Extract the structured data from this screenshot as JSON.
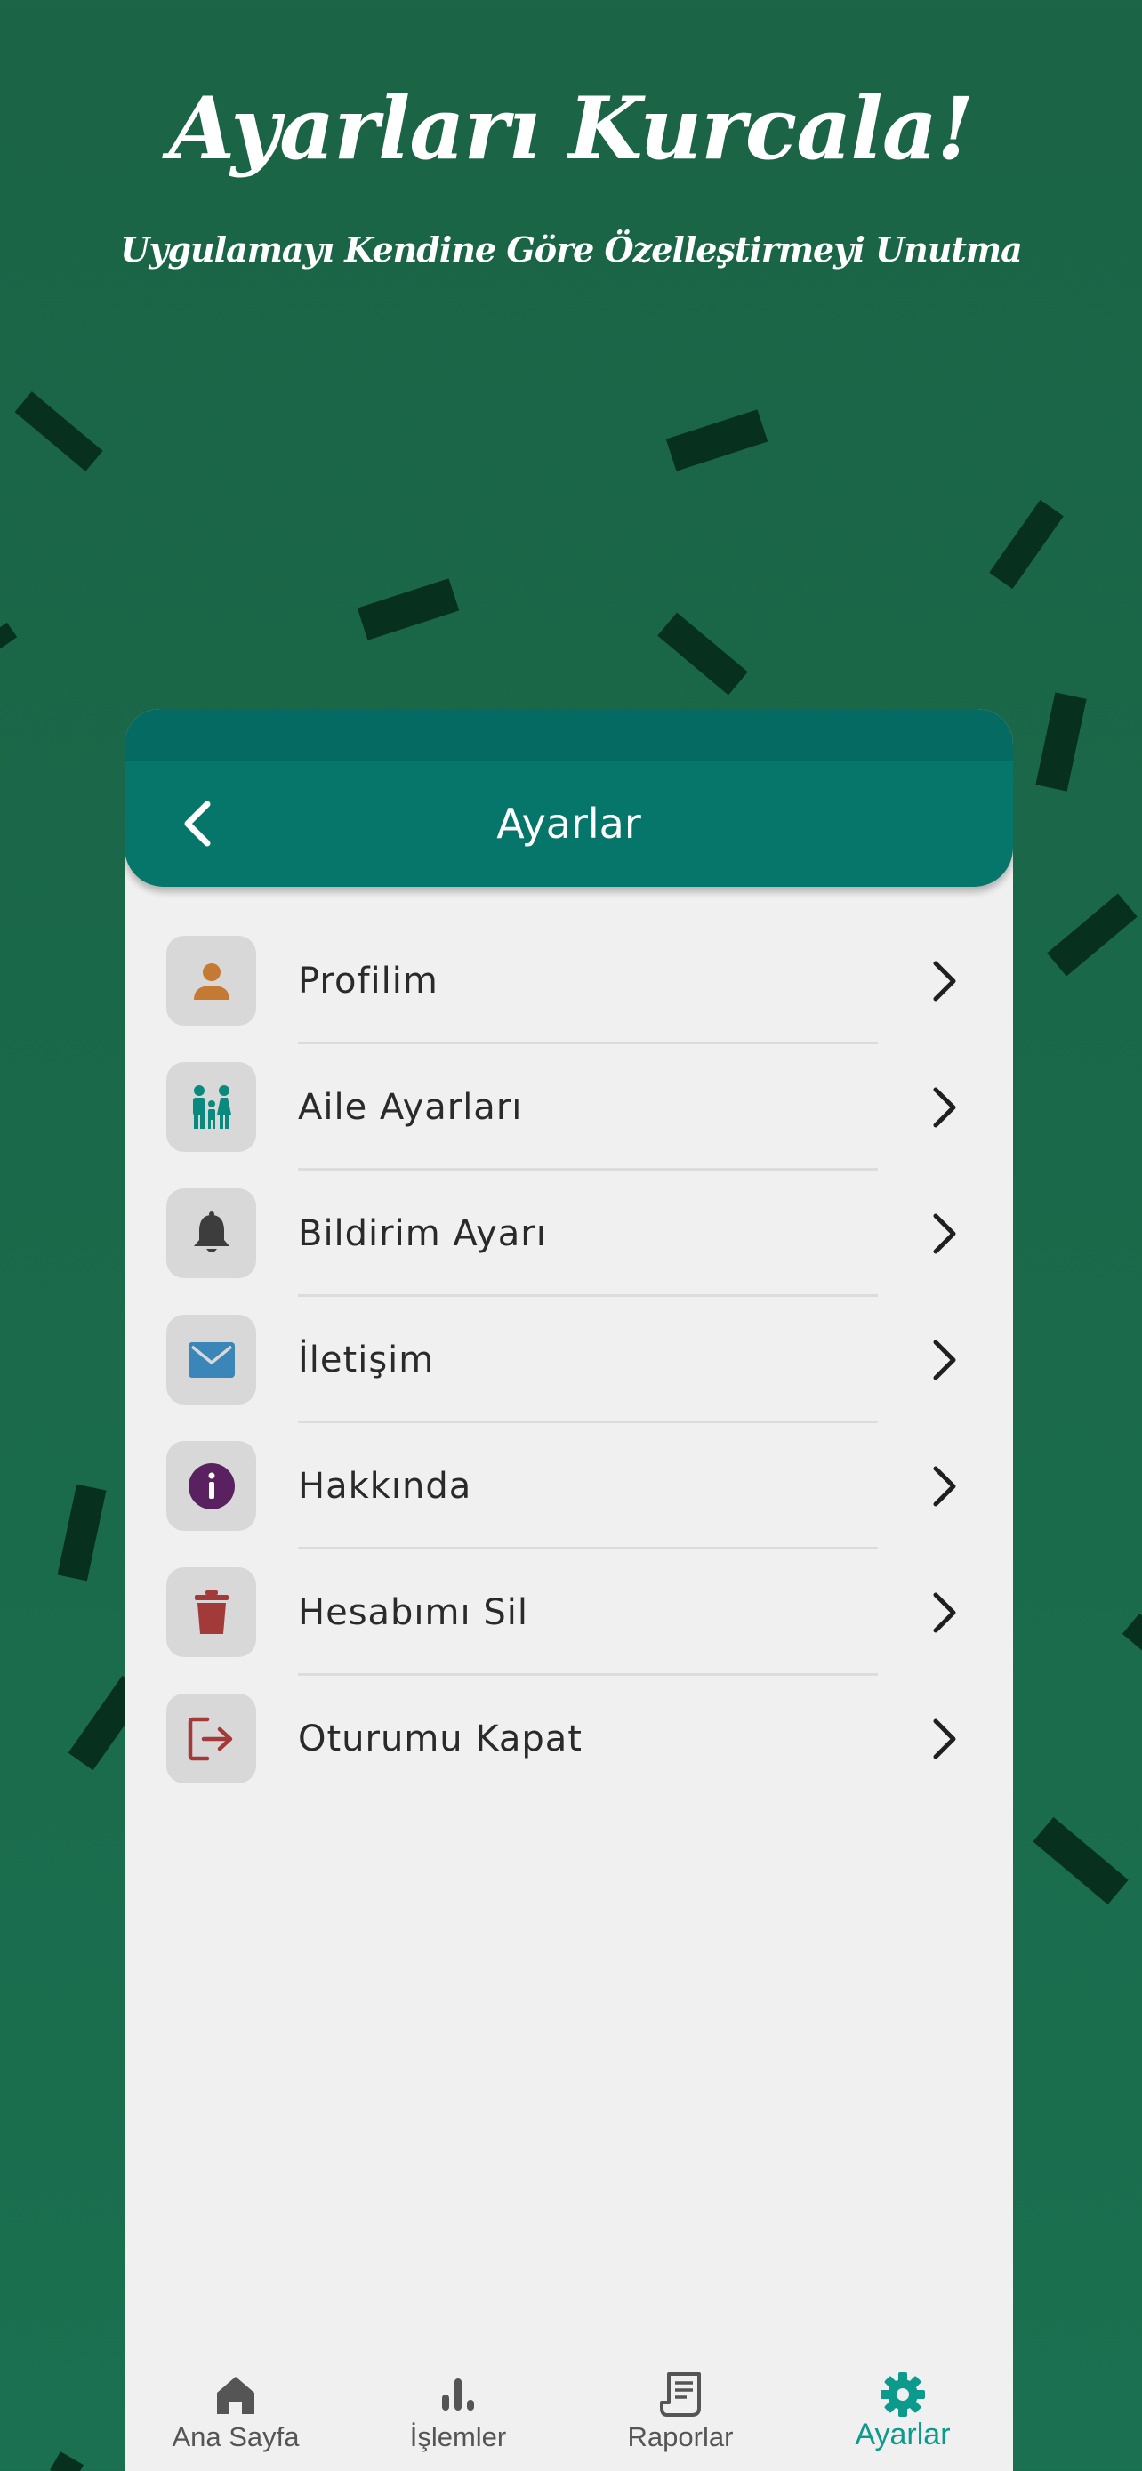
{
  "hero": {
    "title": "Ayarları Kurcala!",
    "subtitle": "Uygulamayı Kendine Göre Özelleştirmeyi Unutma"
  },
  "header": {
    "title": "Ayarlar",
    "back_icon": "chevron-left-icon"
  },
  "menu": [
    {
      "label": "Profilim",
      "icon": "person-icon",
      "icon_color": "#c47a33"
    },
    {
      "label": "Aile Ayarları",
      "icon": "family-icon",
      "icon_color": "#0a8a7e"
    },
    {
      "label": "Bildirim Ayarı",
      "icon": "bell-icon",
      "icon_color": "#3d3d3d"
    },
    {
      "label": "İletişim",
      "icon": "mail-icon",
      "icon_color": "#3a86b8"
    },
    {
      "label": "Hakkında",
      "icon": "info-icon",
      "icon_color": "#5a2160"
    },
    {
      "label": "Hesabımı Sil",
      "icon": "trash-icon",
      "icon_color": "#a33a3a"
    },
    {
      "label": "Oturumu Kapat",
      "icon": "logout-icon",
      "icon_color": "#a33a3a"
    }
  ],
  "bottom_nav": [
    {
      "label": "Ana Sayfa",
      "icon": "home-icon",
      "active": false
    },
    {
      "label": "İşlemler",
      "icon": "bar-chart-icon",
      "active": false
    },
    {
      "label": "Raporlar",
      "icon": "receipt-icon",
      "active": false
    },
    {
      "label": "Ayarlar",
      "icon": "gear-icon",
      "active": true
    }
  ],
  "colors": {
    "background": "#1b6446",
    "header": "#06766a",
    "active_nav": "#0b9a8c",
    "confetti": "#07301f"
  }
}
